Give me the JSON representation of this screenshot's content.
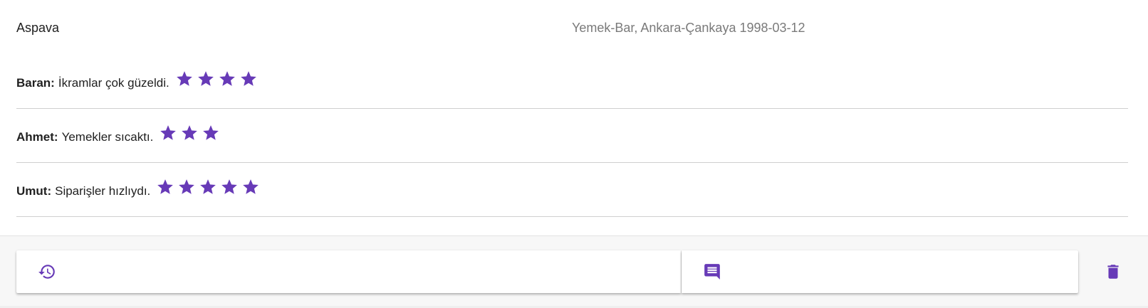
{
  "restaurant": {
    "name": "Aspava",
    "meta": "Yemek-Bar, Ankara-Çankaya 1998-03-12"
  },
  "reviews": [
    {
      "author": "Baran:",
      "text": "İkramlar çok güzeldi.",
      "rating": 4
    },
    {
      "author": "Ahmet:",
      "text": "Yemekler sıcaktı.",
      "rating": 3
    },
    {
      "author": "Umut:",
      "text": "Siparişler hızlıydı.",
      "rating": 5
    }
  ],
  "actions": {
    "history_icon": "history-icon",
    "comment_icon": "comment-icon",
    "delete_icon": "trash-icon"
  },
  "colors": {
    "accent": "#673ab7",
    "divider": "#cfcfcf",
    "meta_text": "#7a7a7a"
  }
}
